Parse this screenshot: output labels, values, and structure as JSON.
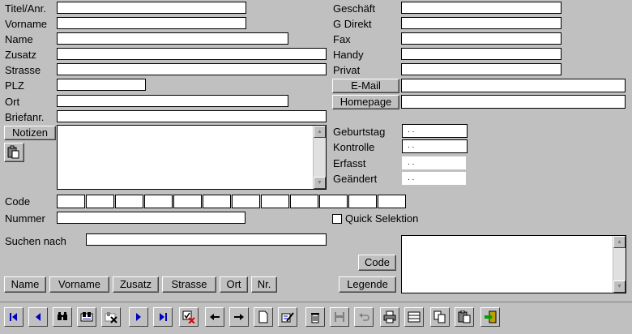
{
  "left_labels": {
    "titel": "Titel/Anr.",
    "vorname": "Vorname",
    "name": "Name",
    "zusatz": "Zusatz",
    "strasse": "Strasse",
    "plz": "PLZ",
    "ort": "Ort",
    "briefanr": "Briefanr."
  },
  "right_labels": {
    "geschaeft": "Geschäft",
    "gdirekt": "G Direkt",
    "fax": "Fax",
    "handy": "Handy",
    "privat": "Privat",
    "geburtstag": "Geburtstag",
    "kontrolle": "Kontrolle",
    "erfasst": "Erfasst",
    "geaendert": "Geändert"
  },
  "buttons": {
    "email": "E-Mail",
    "homepage": "Homepage",
    "notizen": "Notizen",
    "code": "Code",
    "legende": "Legende"
  },
  "dates": {
    "geburtstag": ". .",
    "kontrolle": ". .",
    "erfasst": ". .",
    "geaendert": ". ."
  },
  "lower_labels": {
    "code": "Code",
    "nummer": "Nummer",
    "suchen_nach": "Suchen nach",
    "quick_selektion": "Quick Selektion"
  },
  "sort_buttons": {
    "name": "Name",
    "vorname": "Vorname",
    "zusatz": "Zusatz",
    "strasse": "Strasse",
    "ort": "Ort",
    "nr": "Nr."
  },
  "colors": {
    "background": "#c0c0c0",
    "nav_blue": "#0000c0",
    "delete_red": "#e00000"
  },
  "toolbar_icons": [
    "first-record-icon",
    "prev-record-icon",
    "find-icon",
    "find-filter-icon",
    "clear-filter-icon",
    "next-record-icon",
    "last-record-icon",
    "check-delete-icon",
    "arrow-left-icon",
    "arrow-right-icon",
    "new-document-icon",
    "edit-icon",
    "trash-icon",
    "save-icon",
    "undo-icon",
    "print-icon",
    "form-view-icon",
    "copy-icon",
    "paste-icon",
    "exit-icon"
  ]
}
